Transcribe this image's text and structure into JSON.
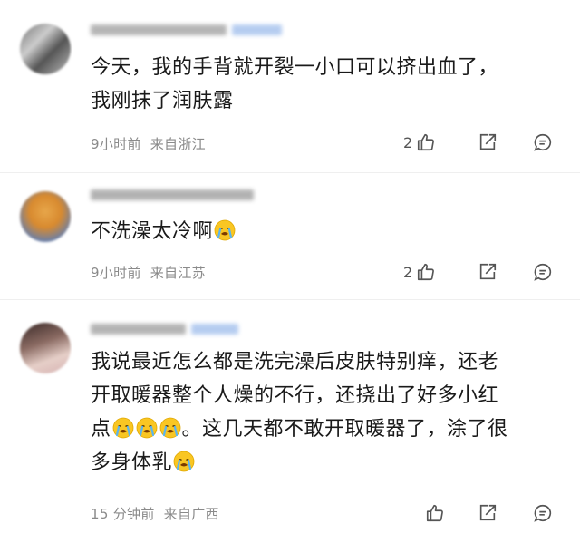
{
  "comments": [
    {
      "text_lines": [
        "今天，我的手背就开裂一小口可以挤出血了，",
        "我刚抹了润肤露"
      ],
      "time": "9小时前",
      "location": "来自浙江",
      "likes": "2"
    },
    {
      "text_lines": [
        "不洗澡太冷啊"
      ],
      "time": "9小时前",
      "location": "来自江苏",
      "likes": "2"
    },
    {
      "text_lines": [
        "我说最近怎么都是洗完澡后皮肤特别痒，还老",
        "开取暖器整个人燥的不行，还挠出了好多小红",
        "点",
        "。这几天都不敢开取暖器了，涂了很",
        "多身体乳"
      ],
      "time": "15 分钟前",
      "location": "来自广西",
      "likes": ""
    }
  ],
  "icons": {
    "like": "thumbs-up-icon",
    "share": "share-arrow-icon",
    "reply": "comment-bubble-icon",
    "emoji": "crying-face-emoji"
  },
  "colors": {
    "meta_text": "#8a8a8a",
    "icon": "#666666",
    "username_blur": "#b9c9e8"
  }
}
